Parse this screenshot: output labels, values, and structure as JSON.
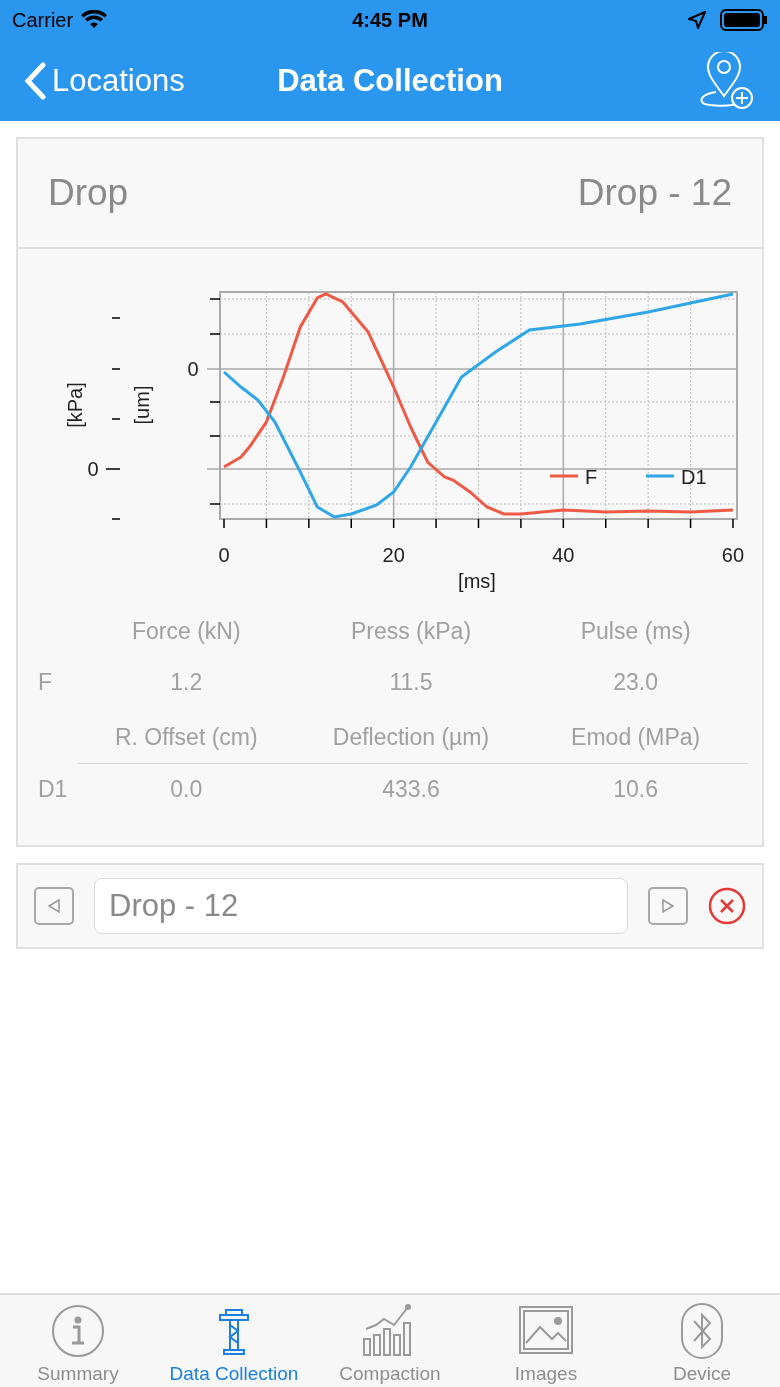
{
  "status_bar": {
    "carrier": "Carrier",
    "time": "4:45 PM"
  },
  "nav": {
    "back": "Locations",
    "title": "Data Collection"
  },
  "drop_header": {
    "label": "Drop",
    "value": "Drop - 12"
  },
  "chart": {
    "y_labels": [
      "[kPa]",
      "[um]"
    ],
    "kpa_zero": "0",
    "um_zero": "0",
    "xticks": [
      "0",
      "20",
      "40",
      "60"
    ],
    "xlabel": "[ms]",
    "legend": [
      {
        "name": "F",
        "color": "#ee5a45"
      },
      {
        "name": "D1",
        "color": "#2ea6e8"
      }
    ]
  },
  "results": [
    {
      "headers": [
        "Force (kN)",
        "Press (kPa)",
        "Pulse (ms)"
      ],
      "row_label": "F",
      "values": [
        "1.2",
        "11.5",
        "23.0"
      ]
    },
    {
      "headers": [
        "R. Offset (cm)",
        "Deflection (µm)",
        "Emod (MPa)"
      ],
      "row_label": "D1",
      "values": [
        "0.0",
        "433.6",
        "10.6"
      ]
    }
  ],
  "navigator": {
    "field_value": "Drop - 12"
  },
  "tabs": [
    {
      "label": "Summary",
      "kind": "info",
      "selected": false
    },
    {
      "label": "Data Collection",
      "kind": "tower",
      "selected": true
    },
    {
      "label": "Compaction",
      "kind": "chart",
      "selected": false
    },
    {
      "label": "Images",
      "kind": "image",
      "selected": false
    },
    {
      "label": "Device",
      "kind": "bluetooth",
      "selected": false
    }
  ]
}
